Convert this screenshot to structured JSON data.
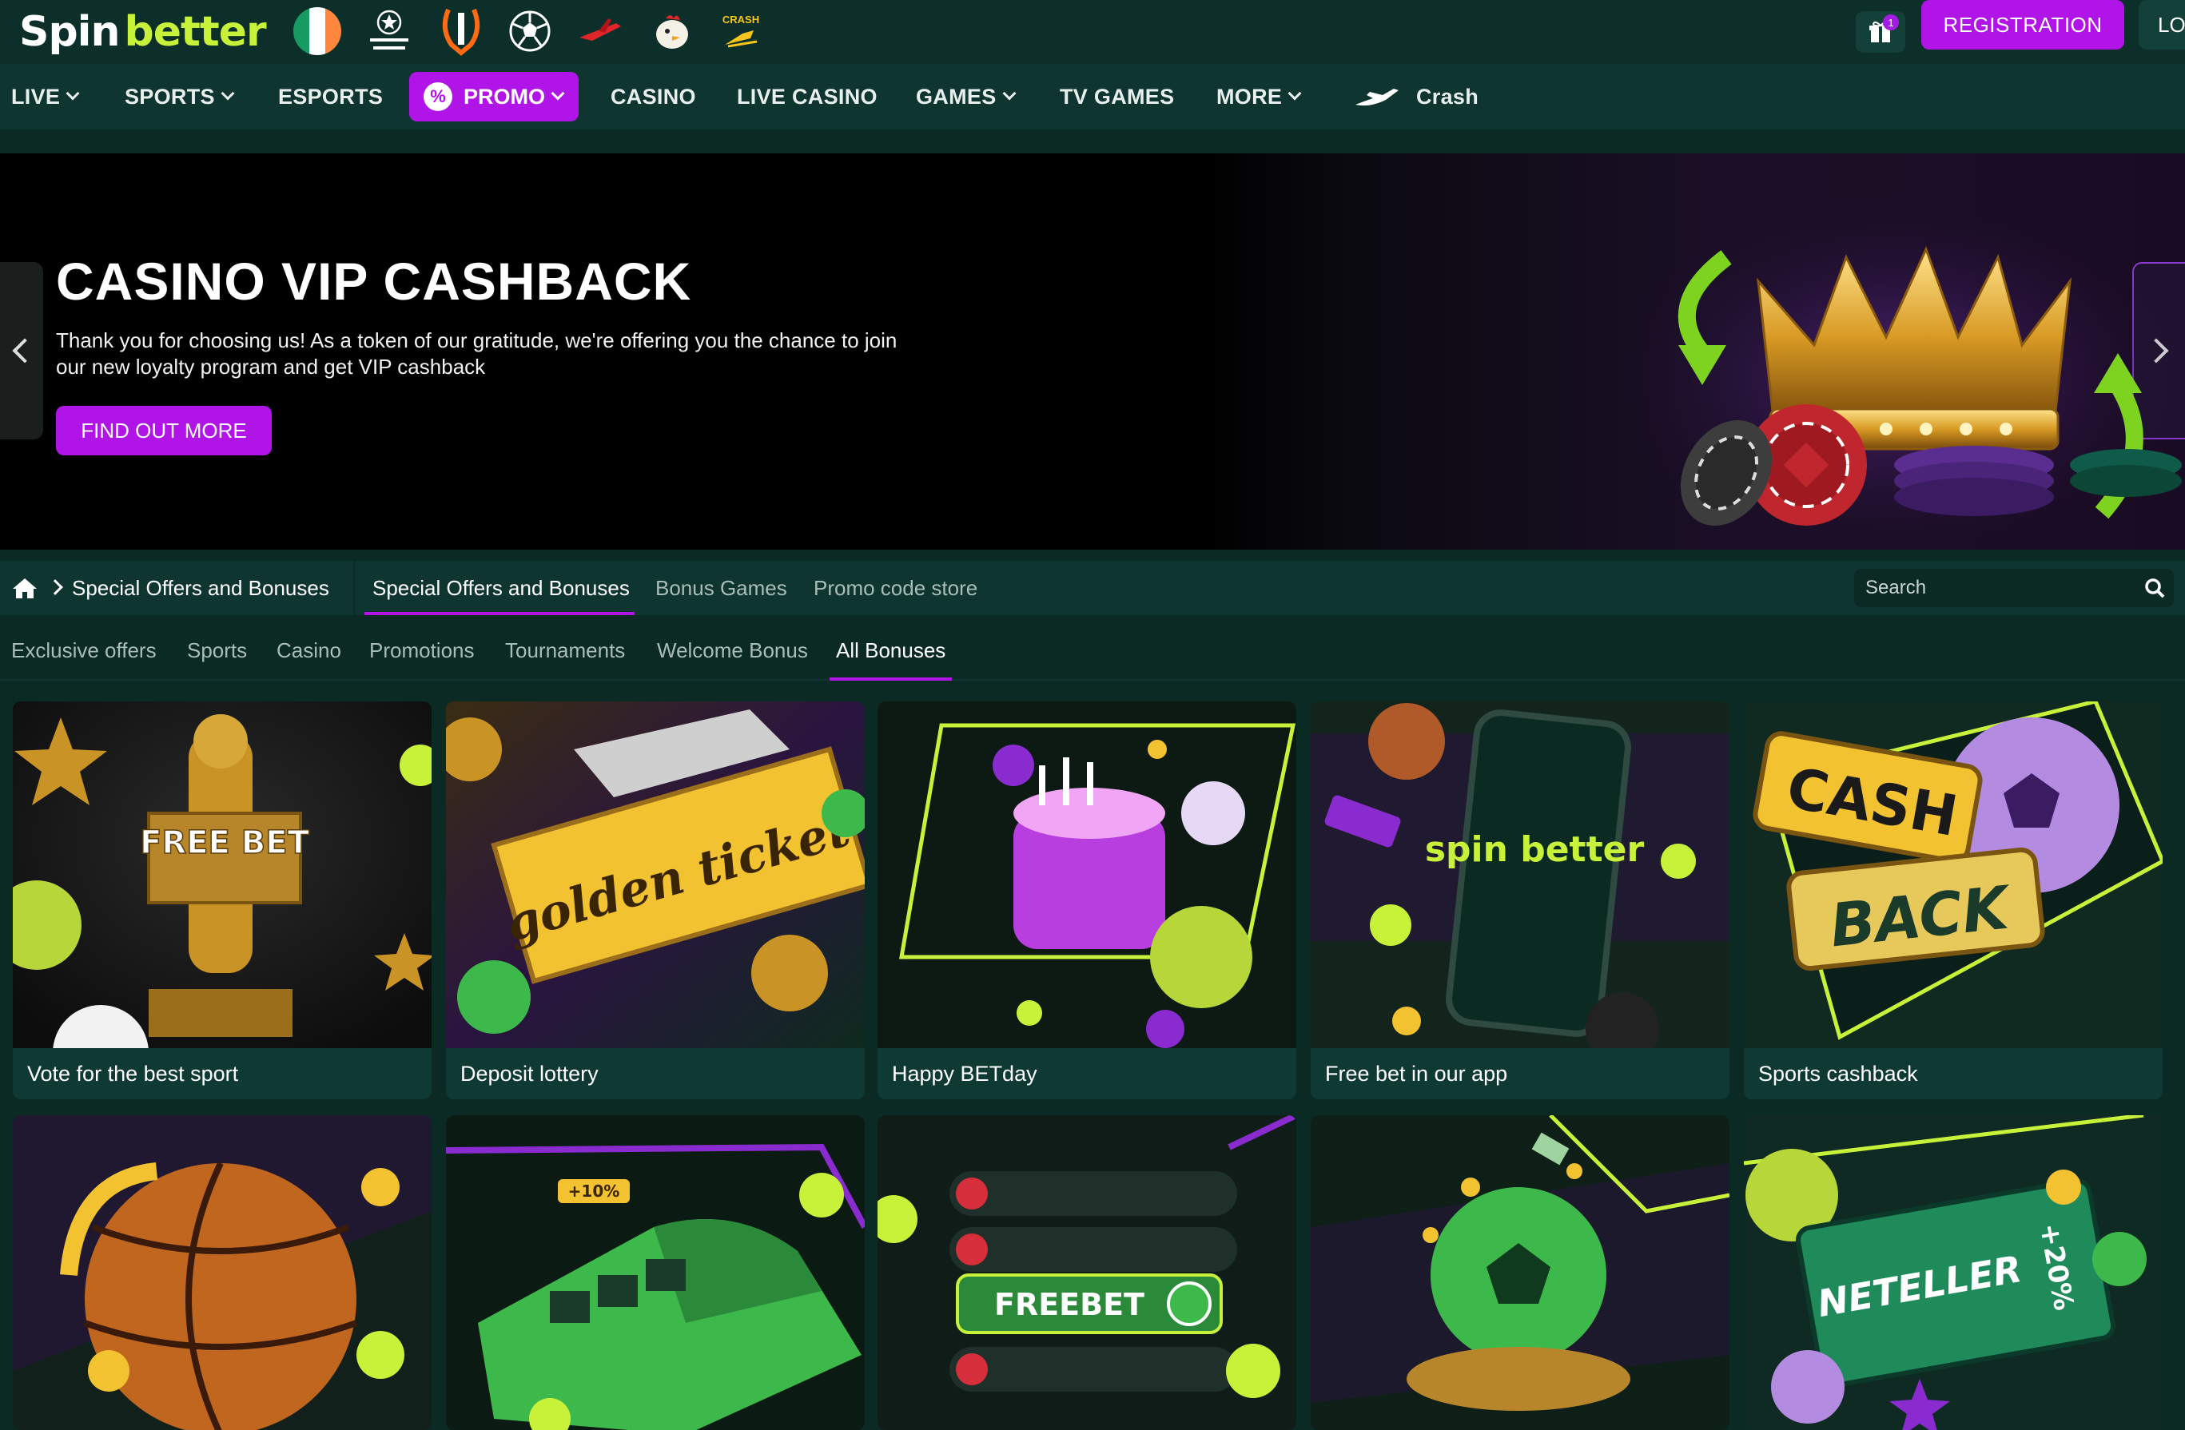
{
  "brand": {
    "logo_part1": "Spin",
    "logo_part2": "better"
  },
  "quick_links": [
    {
      "icon": "ireland-flag-icon"
    },
    {
      "icon": "champions-league-icon"
    },
    {
      "icon": "europa-league-icon"
    },
    {
      "icon": "football-icon"
    },
    {
      "icon": "aviator-plane-icon"
    },
    {
      "icon": "chicken-game-icon"
    },
    {
      "icon": "crash-game-icon",
      "label": "CRASH"
    }
  ],
  "header": {
    "gift_badge": "1",
    "registration": "REGISTRATION",
    "login": "LO"
  },
  "nav": {
    "live": "LIVE",
    "sports": "SPORTS",
    "esports": "ESPORTS",
    "promo": "PROMO",
    "casino": "CASINO",
    "live_casino": "LIVE CASINO",
    "games": "GAMES",
    "tv_games": "TV GAMES",
    "more": "MORE",
    "crash": "Crash"
  },
  "banner": {
    "title": "CASINO VIP CASHBACK",
    "text": "Thank you for choosing us! As a token of our gratitude, we're offering you the chance to join our new loyalty program and get VIP cashback",
    "button": "FIND OUT MORE"
  },
  "breadcrumb": {
    "current": "Special Offers and Bonuses"
  },
  "section_tabs": [
    "Special Offers and Bonuses",
    "Bonus Games",
    "Promo code store"
  ],
  "search": {
    "placeholder": "Search"
  },
  "categories": [
    "Exclusive offers",
    "Sports",
    "Casino",
    "Promotions",
    "Tournaments",
    "Welcome Bonus",
    "All Bonuses"
  ],
  "cards": [
    {
      "title": "Vote for the best sport",
      "art_text": "FREE BET"
    },
    {
      "title": "Deposit lottery",
      "art_text": "golden ticket"
    },
    {
      "title": "Happy BETday"
    },
    {
      "title": "Free bet in our app",
      "art_text": "spin better"
    },
    {
      "title": "Sports cashback",
      "art_text_1": "CASH",
      "art_text_2": "BACK"
    },
    {
      "title": ""
    },
    {
      "title": "",
      "art_text": "+10%"
    },
    {
      "title": "",
      "art_text": "FREEBET"
    },
    {
      "title": ""
    },
    {
      "title": "",
      "art_text": "NETELLER",
      "art_text_2": "+20%"
    }
  ],
  "colors": {
    "accent": "#b114e6",
    "background": "#0b2a24",
    "nav": "#0f3530",
    "lime": "#c8f23a"
  }
}
